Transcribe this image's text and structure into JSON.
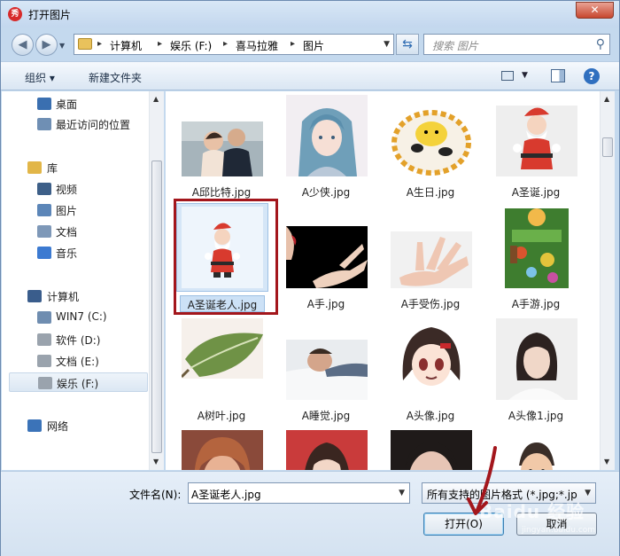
{
  "window": {
    "title": "打开图片",
    "app_icon_glyph": "秀",
    "close_glyph": "✕"
  },
  "nav_buttons": {
    "back_glyph": "◀",
    "forward_glyph": "▶"
  },
  "address": {
    "crumbs": [
      "计算机",
      "娱乐 (F:)",
      "喜马拉雅",
      "图片"
    ],
    "separator": "▸"
  },
  "search": {
    "placeholder": "搜索 图片"
  },
  "toolbar": {
    "organize_label": "组织 ▾",
    "new_folder_label": "新建文件夹"
  },
  "sidebar": {
    "items": [
      {
        "label": "桌面",
        "icon": "desktop-icon",
        "color": "#3a6fb0"
      },
      {
        "label": "最近访问的位置",
        "icon": "recent-places-icon",
        "color": "#6f8fb4"
      },
      {
        "label": "库",
        "icon": "library-icon",
        "color": "#e2b648"
      },
      {
        "label": "视频",
        "icon": "video-icon",
        "color": "#3d5f88"
      },
      {
        "label": "图片",
        "icon": "pictures-icon",
        "color": "#5c86b8"
      },
      {
        "label": "文档",
        "icon": "documents-icon",
        "color": "#7e98b8"
      },
      {
        "label": "音乐",
        "icon": "music-icon",
        "color": "#3c7ad1"
      },
      {
        "label": "计算机",
        "icon": "computer-icon",
        "color": "#3a5d8c"
      },
      {
        "label": "WIN7 (C:)",
        "icon": "system-drive-icon",
        "color": "#6f8db0"
      },
      {
        "label": "软件 (D:)",
        "icon": "drive-icon",
        "color": "#9aa3ad"
      },
      {
        "label": "文档 (E:)",
        "icon": "drive-icon",
        "color": "#9aa3ad"
      },
      {
        "label": "娱乐 (F:)",
        "icon": "drive-icon",
        "color": "#9aa3ad",
        "selected": true
      },
      {
        "label": "网络",
        "icon": "network-icon",
        "color": "#3b73b8"
      }
    ]
  },
  "files": [
    {
      "name": "A邱比特.jpg",
      "icon": "photo-couple-icon"
    },
    {
      "name": "A少侠.jpg",
      "icon": "photo-anime-swordsman-icon"
    },
    {
      "name": "A生日.jpg",
      "icon": "photo-birthday-cake-icon"
    },
    {
      "name": "A圣诞.jpg",
      "icon": "photo-santa-icon"
    },
    {
      "name": "A圣诞老人.jpg",
      "icon": "photo-santa-small-icon",
      "selected": true
    },
    {
      "name": "A手.jpg",
      "icon": "photo-hand-icon"
    },
    {
      "name": "A手受伤.jpg",
      "icon": "photo-injured-hand-icon"
    },
    {
      "name": "A手游.jpg",
      "icon": "photo-mobile-game-icon"
    },
    {
      "name": "A树叶.jpg",
      "icon": "photo-leaf-icon"
    },
    {
      "name": "A睡觉.jpg",
      "icon": "photo-sleeping-icon"
    },
    {
      "name": "A头像.jpg",
      "icon": "photo-anime-avatar-icon"
    },
    {
      "name": "A头像1.jpg",
      "icon": "photo-portrait-icon"
    },
    {
      "name": "",
      "icon": "photo-doll-icon"
    },
    {
      "name": "",
      "icon": "photo-woman-icon"
    },
    {
      "name": "",
      "icon": "photo-woman-face-icon"
    },
    {
      "name": "",
      "icon": "photo-cartoon-man-icon"
    }
  ],
  "footer": {
    "filename_label": "文件名(N):",
    "filename_value": "A圣诞老人.jpg",
    "filter_value": "所有支持的图片格式 (*.jpg;*.jp",
    "open_label": "打开(O)",
    "cancel_label": "取消"
  },
  "watermark": {
    "text": "Baidu 经验",
    "subtext": "jingyan.baidu.com"
  },
  "colors": {
    "annotation_red": "#a3161c",
    "selection_blue": "#cce1f6"
  }
}
